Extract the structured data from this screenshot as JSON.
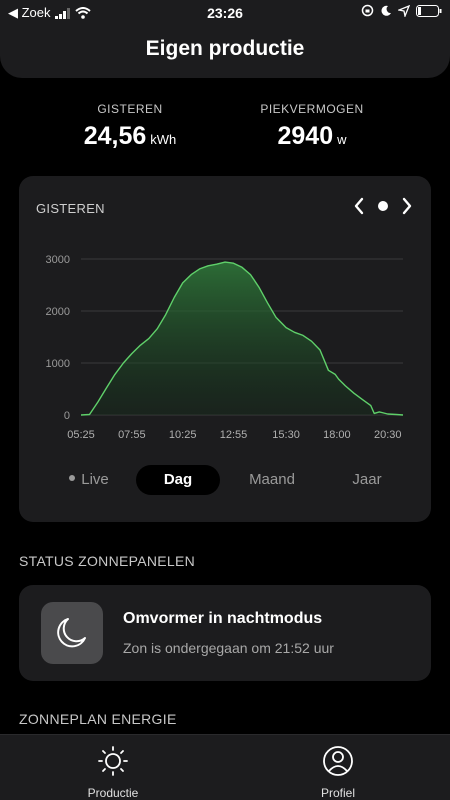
{
  "statusbar": {
    "carrier": "◀ Zoek",
    "time": "23:26"
  },
  "header": {
    "title": "Eigen productie"
  },
  "stats": {
    "yesterday": {
      "label": "GISTEREN",
      "value": "24,56",
      "unit": "kWh"
    },
    "peak": {
      "label": "PIEKVERMOGEN",
      "value": "2940",
      "unit": "w"
    }
  },
  "chart_card": {
    "title": "GISTEREN"
  },
  "chart_data": {
    "type": "area",
    "title": "GISTEREN",
    "xlabel": "",
    "ylabel": "",
    "x_tick_labels": [
      "05:25",
      "07:55",
      "10:25",
      "12:55",
      "15:30",
      "18:00",
      "20:30"
    ],
    "y_tick_labels": [
      "0",
      "1000",
      "2000",
      "3000"
    ],
    "ylim": [
      0,
      3000
    ],
    "xlim": [
      "05:25",
      "21:15"
    ],
    "grid": true,
    "color": "#5fd06a",
    "series": [
      {
        "x": [
          "05:25",
          "05:50",
          "06:15",
          "06:40",
          "07:05",
          "07:30",
          "07:55",
          "08:20",
          "08:45",
          "09:10",
          "09:35",
          "10:00",
          "10:25",
          "10:50",
          "11:15",
          "11:40",
          "12:05",
          "12:30",
          "12:55",
          "13:20",
          "13:45",
          "14:10",
          "14:35",
          "15:00",
          "15:30",
          "15:55",
          "16:20",
          "16:45",
          "17:10",
          "17:35",
          "17:55",
          "18:05",
          "18:25",
          "18:50",
          "19:15",
          "19:40",
          "19:50",
          "20:05",
          "20:30",
          "20:55",
          "21:15"
        ],
        "values": [
          0,
          10,
          250,
          520,
          780,
          1000,
          1180,
          1340,
          1470,
          1660,
          1930,
          2260,
          2540,
          2700,
          2810,
          2870,
          2900,
          2940,
          2920,
          2840,
          2700,
          2460,
          2160,
          1880,
          1680,
          1590,
          1530,
          1420,
          1250,
          860,
          780,
          690,
          560,
          420,
          300,
          180,
          30,
          60,
          20,
          10,
          0
        ]
      }
    ]
  },
  "periods": [
    {
      "label": "Live"
    },
    {
      "label": "Dag"
    },
    {
      "label": "Maand"
    },
    {
      "label": "Jaar"
    }
  ],
  "status_section": {
    "heading": "STATUS ZONNEPANELEN"
  },
  "status": {
    "title": "Omvormer in nachtmodus",
    "subtitle": "Zon is ondergegaan om 21:52 uur",
    "icon": "moon-icon"
  },
  "energy_section": {
    "heading": "ZONNEPLAN ENERGIE"
  },
  "tabs": [
    {
      "label": "Productie",
      "icon": "sun-icon"
    },
    {
      "label": "Profiel",
      "icon": "person-icon"
    }
  ]
}
